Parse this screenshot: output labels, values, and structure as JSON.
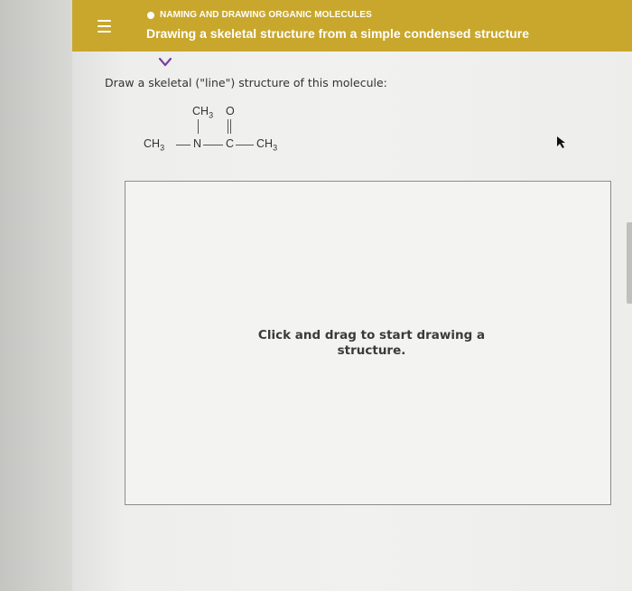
{
  "header": {
    "topic": "NAMING AND DRAWING ORGANIC MOLECULES",
    "title": "Drawing a skeletal structure from a simple condensed structure"
  },
  "question": {
    "prompt": "Draw a skeletal (\"line\") structure of this molecule:"
  },
  "molecule": {
    "ch3_left": "CH",
    "ch3_top": "CH",
    "ch3_right": "CH",
    "sub3": "3",
    "n": "N",
    "c": "C",
    "o": "O"
  },
  "canvas": {
    "hint": "Click and drag to start drawing a structure."
  },
  "colors": {
    "header_bg": "#c8a72c",
    "header_text": "#ffffff",
    "chevron": "#7b3fa0",
    "text": "#333333"
  }
}
